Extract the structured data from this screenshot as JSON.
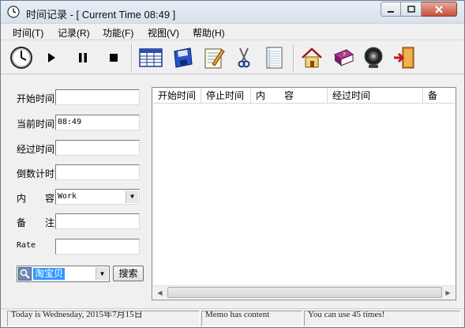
{
  "window": {
    "title": "时间记录 - [ Current Time 08:49 ]"
  },
  "menu": [
    "时间(T)",
    "记录(R)",
    "功能(F)",
    "视图(V)",
    "帮助(H)"
  ],
  "toolbar": {
    "icons": [
      "clock-icon",
      "play-icon",
      "pause-icon",
      "stop-icon",
      "table-icon",
      "save-disk-icon",
      "edit-notepad-icon",
      "scissors-icon",
      "notebook-icon",
      "home-icon",
      "book-help-icon",
      "webcam-icon",
      "exit-door-icon"
    ]
  },
  "form": {
    "start_time_label": "开始时间",
    "start_time_value": "",
    "current_time_label": "当前时间",
    "current_time_value": "08:49",
    "elapsed_label": "经过时间",
    "elapsed_value": "",
    "countdown_label": "倒数计时",
    "countdown_value": "",
    "content_label": "内　　容",
    "content_value": "Work",
    "memo_label": "备　　注",
    "memo_value": "",
    "rate_label": "Rate",
    "rate_value": ""
  },
  "search": {
    "engine_value": "淘宝贝",
    "button_label": "搜索"
  },
  "list": {
    "columns": [
      "开始时间",
      "停止时间",
      "内　　容",
      "经过时间",
      "备"
    ]
  },
  "status": {
    "left": "Today is Wednesday, 2015年7月15日",
    "middle": "Memo has content",
    "right": "You can use 45 times!"
  },
  "colors": {
    "selection": "#3399ff",
    "window_bg": "#f0f0f0"
  }
}
